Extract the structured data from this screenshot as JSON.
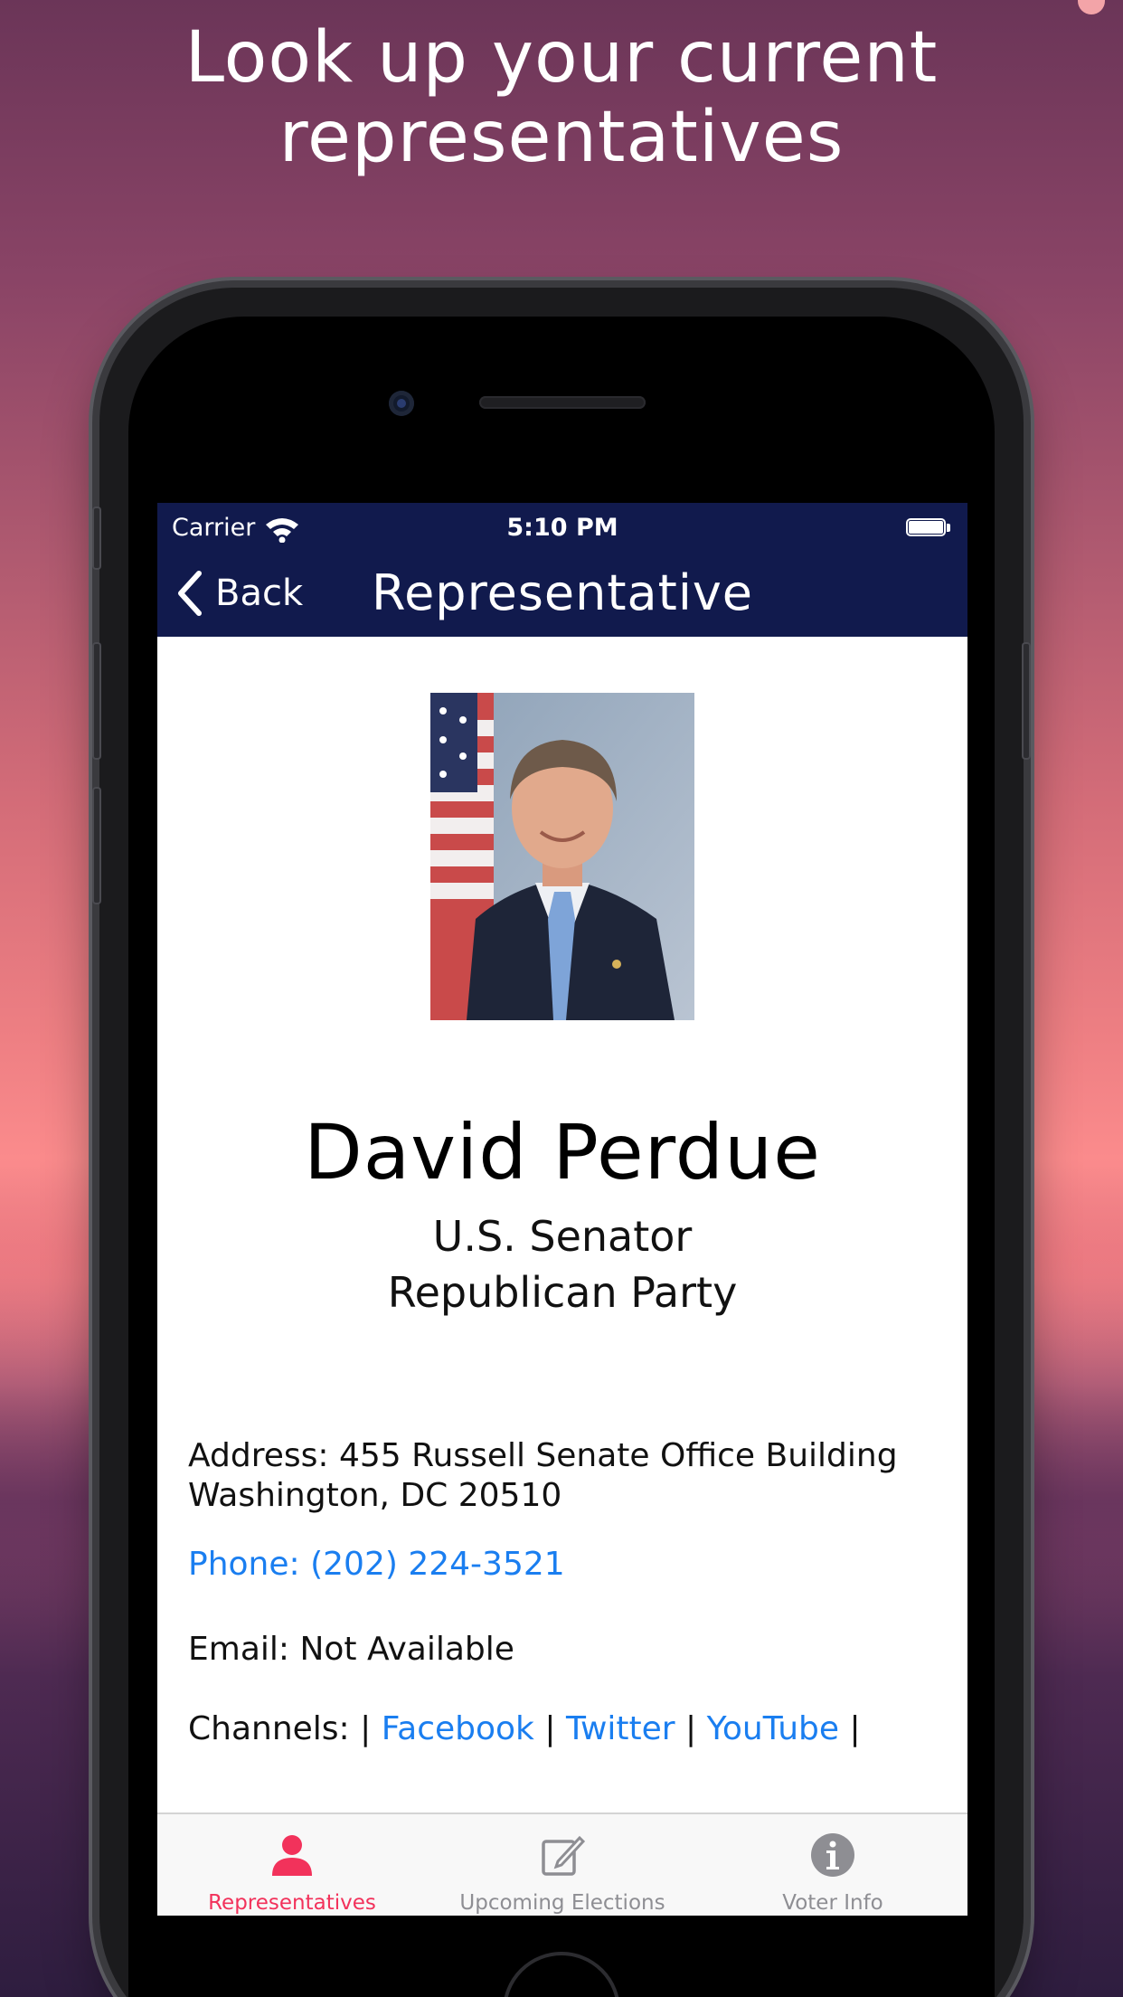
{
  "headline": {
    "line1": "Look up your current",
    "line2": "representatives"
  },
  "status_bar": {
    "carrier": "Carrier",
    "time": "5:10 PM"
  },
  "nav": {
    "back_label": "Back",
    "title": "Representative"
  },
  "representative": {
    "name": "David Perdue",
    "office": "U.S. Senator",
    "party": "Republican Party",
    "address_line1": "Address: 455 Russell Senate Office Building",
    "address_line2": "Washington, DC 20510",
    "phone": "Phone: (202) 224-3521",
    "email": "Email: Not Available",
    "channels_label": "Channels:",
    "separator": "|",
    "channels": [
      "Facebook",
      "Twitter",
      "YouTube"
    ]
  },
  "tabbar": {
    "tabs": [
      {
        "label": "Representatives",
        "selected": true
      },
      {
        "label": "Upcoming Elections",
        "selected": false
      },
      {
        "label": "Voter Info",
        "selected": false
      }
    ]
  },
  "colors": {
    "nav_background": "#111a4d",
    "link": "#1a7ef0",
    "tab_active": "#f2325b",
    "tab_inactive": "#8e8e93"
  }
}
